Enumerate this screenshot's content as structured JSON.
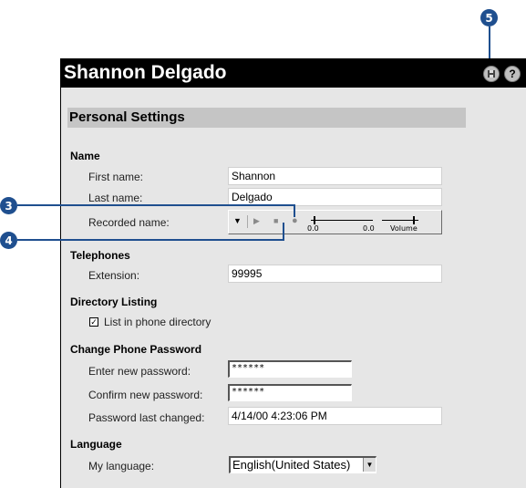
{
  "callouts": {
    "five": "5",
    "three": "3",
    "four": "4"
  },
  "header": {
    "title": "Shannon Delgado",
    "save_icon": "save-disk-icon",
    "help_glyph": "?"
  },
  "section": {
    "title": "Personal Settings"
  },
  "name_group": {
    "title": "Name",
    "first_name_label": "First name:",
    "first_name_value": "Shannon",
    "last_name_label": "Last name:",
    "last_name_value": "Delgado",
    "recorded_label": "Recorded name:"
  },
  "recorder": {
    "pos_value": "0.0",
    "dur_value": "0.0",
    "volume_label": "Volume"
  },
  "telephones": {
    "title": "Telephones",
    "extension_label": "Extension:",
    "extension_value": "99995"
  },
  "directory": {
    "title": "Directory Listing",
    "checkbox_label": "List in phone directory",
    "checked": true
  },
  "password": {
    "title": "Change Phone Password",
    "new_label": "Enter new password:",
    "new_value": "******",
    "confirm_label": "Confirm new password:",
    "confirm_value": "******",
    "changed_label": "Password last changed:",
    "changed_value": "4/14/00 4:23:06 PM"
  },
  "language": {
    "title": "Language",
    "label": "My language:",
    "value": "English(United States)"
  },
  "colors": {
    "accent": "#1f4f8f",
    "panel": "#e6e6e6",
    "titlebar": "#000000",
    "section_header": "#c5c5c5"
  }
}
